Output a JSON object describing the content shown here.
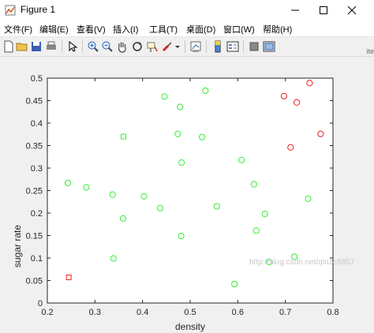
{
  "window": {
    "title": "Figure 1"
  },
  "menu": [
    "文件(F)",
    "编辑(E)",
    "查看(V)",
    "插入(I)",
    "工具(T)",
    "桌面(D)",
    "窗口(W)",
    "帮助(H)"
  ],
  "toolbar_icons": [
    "new-figure-icon",
    "open-file-icon",
    "save-icon",
    "print-icon",
    "select-arrow-icon",
    "zoom-in-icon",
    "zoom-out-icon",
    "pan-hand-icon",
    "rotate-3d-icon",
    "data-cursor-icon",
    "brush-icon",
    "brush-dropdown-icon",
    "link-plot-icon",
    "colorbar-icon",
    "legend-icon",
    "hide-plot-tools-icon",
    "show-plot-tools-icon"
  ],
  "side_marker": "ite",
  "watermark": "http://blog.csdn.net/qinze5857",
  "colors": {
    "green": "#33ee33",
    "red": "#ee2222",
    "axes_bg": "#ffffff",
    "figure_bg": "#f0f0f0"
  },
  "chart_data": {
    "type": "scatter",
    "title": "",
    "xlabel": "density",
    "ylabel": "sugar rate",
    "xlim": [
      0.2,
      0.8
    ],
    "ylim": [
      0,
      0.5
    ],
    "xticks": [
      "0.2",
      "0.3",
      "0.4",
      "0.5",
      "0.6",
      "0.7",
      "0.8"
    ],
    "yticks": [
      "0",
      "0.05",
      "0.1",
      "0.15",
      "0.2",
      "0.25",
      "0.3",
      "0.35",
      "0.4",
      "0.45",
      "0.5"
    ],
    "grid": false,
    "series": [
      {
        "marker": "circle",
        "color": "green",
        "points": [
          [
            0.243,
            0.267
          ],
          [
            0.282,
            0.257
          ],
          [
            0.337,
            0.241
          ],
          [
            0.339,
            0.099
          ],
          [
            0.359,
            0.188
          ],
          [
            0.403,
            0.237
          ],
          [
            0.437,
            0.211
          ],
          [
            0.446,
            0.459
          ],
          [
            0.474,
            0.376
          ],
          [
            0.479,
            0.436
          ],
          [
            0.481,
            0.149
          ],
          [
            0.482,
            0.312
          ],
          [
            0.525,
            0.369
          ],
          [
            0.532,
            0.472
          ],
          [
            0.556,
            0.215
          ],
          [
            0.593,
            0.042
          ],
          [
            0.608,
            0.318
          ],
          [
            0.634,
            0.264
          ],
          [
            0.639,
            0.161
          ],
          [
            0.657,
            0.198
          ],
          [
            0.666,
            0.091
          ],
          [
            0.719,
            0.103
          ],
          [
            0.748,
            0.232
          ]
        ]
      },
      {
        "marker": "circle",
        "color": "red",
        "points": [
          [
            0.697,
            0.46
          ],
          [
            0.711,
            0.346
          ],
          [
            0.724,
            0.446
          ],
          [
            0.751,
            0.489
          ],
          [
            0.774,
            0.376
          ]
        ]
      },
      {
        "marker": "square",
        "color": "green",
        "points": [
          [
            0.36,
            0.37
          ]
        ]
      },
      {
        "marker": "square",
        "color": "red",
        "points": [
          [
            0.245,
            0.057
          ]
        ]
      }
    ]
  }
}
